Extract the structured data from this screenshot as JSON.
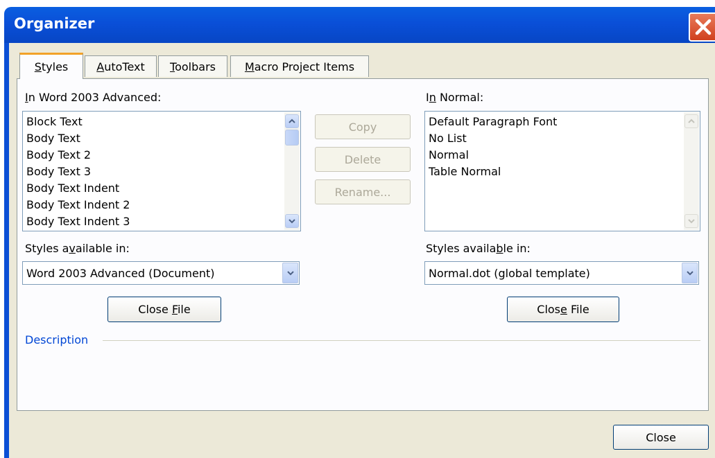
{
  "window": {
    "title": "Organizer"
  },
  "tabs": [
    {
      "pre": "",
      "u": "S",
      "post": "tyles"
    },
    {
      "pre": "",
      "u": "A",
      "post": "utoText"
    },
    {
      "pre": "",
      "u": "T",
      "post": "oolbars"
    },
    {
      "pre": "",
      "u": "M",
      "post": "acro Project Items"
    }
  ],
  "left": {
    "heading": {
      "pre": "",
      "u": "I",
      "post": "n Word 2003 Advanced:"
    },
    "items": [
      "Block Text",
      "Body Text",
      "Body Text 2",
      "Body Text 3",
      "Body Text Indent",
      "Body Text Indent 2",
      "Body Text Indent 3"
    ],
    "avail": {
      "pre": "Styles a",
      "u": "v",
      "post": "ailable in:"
    },
    "combo_value": "Word 2003 Advanced (Document)",
    "close_file": {
      "pre": "Close ",
      "u": "F",
      "post": "ile"
    }
  },
  "right": {
    "heading": {
      "pre": "I",
      "u": "n",
      "post": " Normal:"
    },
    "items": [
      "Default Paragraph Font",
      "No List",
      "Normal",
      "Table Normal"
    ],
    "avail": {
      "pre": "Styles availa",
      "u": "b",
      "post": "le in:"
    },
    "combo_value": "Normal.dot (global template)",
    "close_file": {
      "pre": "Clos",
      "u": "e",
      "post": " File"
    }
  },
  "actions": {
    "copy": "Copy",
    "delete": "Delete",
    "rename": "Rename..."
  },
  "description": {
    "label": "Description"
  },
  "footer": {
    "close": "Close"
  },
  "colors": {
    "title_bar": "#0a4fd8",
    "accent_tab": "#f2a228",
    "description": "#0046d5"
  }
}
